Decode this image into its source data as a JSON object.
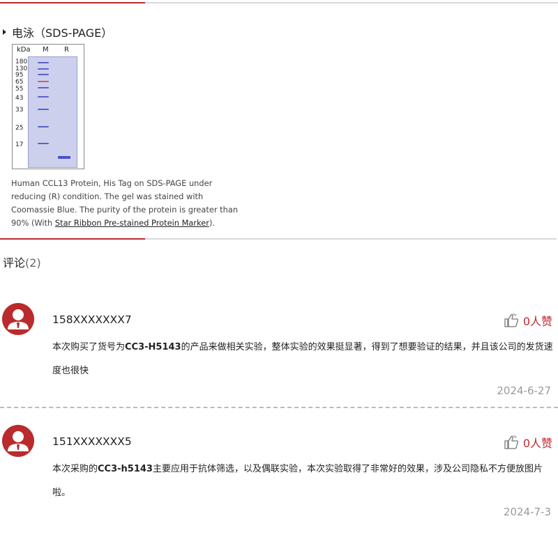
{
  "section": {
    "title": "电泳（SDS-PAGE）"
  },
  "gel": {
    "unit": "kDa",
    "lanes": [
      "M",
      "R"
    ],
    "markers": [
      "180",
      "130",
      "95",
      "65",
      "55",
      "43",
      "33",
      "25",
      "17"
    ]
  },
  "caption": {
    "text": "Human CCL13 Protein, His Tag on SDS-PAGE under reducing (R) condition. The gel was stained with Coomassie Blue. The purity of the protein is greater than 90% (With ",
    "link": "Star Ribbon Pre-stained Protein Marker",
    "end": ")."
  },
  "comments_header": {
    "label": "评论",
    "count": "(2)"
  },
  "comments": [
    {
      "user": "158XXXXXXX7",
      "likes": "0人赞",
      "pre": "本次购买了货号为",
      "code": "CC3-H5143",
      "post": "的产品来做相关实验，整体实验的效果挺显著，得到了想要验证的结果，并且该公司的发货速度也很快",
      "date": "2024-6-27"
    },
    {
      "user": "151XXXXXXX5",
      "likes": "0人赞",
      "pre": "本次采购的",
      "code": "CC3-h5143",
      "post": "主要应用于抗体筛选，以及偶联实验，本次实验取得了非常好的效果，涉及公司隐私不方便放图片啦。",
      "date": "2024-7-3"
    }
  ],
  "colors": {
    "accent": "#c0272d",
    "avatar": "#b92b2c",
    "date": "#9a9a9a"
  },
  "icons": {
    "like": "thumbs-up-icon",
    "avatar": "user-avatar-icon",
    "bullet": "triangle-bullet-icon"
  }
}
